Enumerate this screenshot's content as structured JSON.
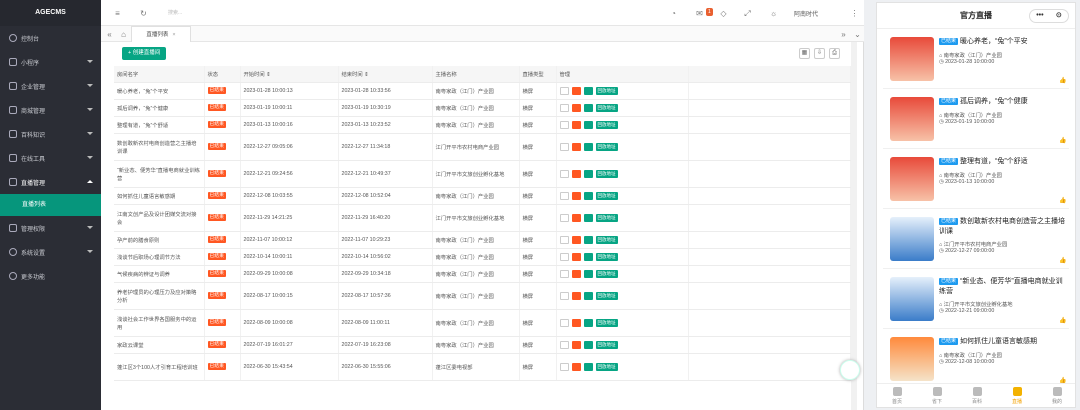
{
  "sidebar": {
    "brand": "AGECMS",
    "items": [
      {
        "label": "控制台",
        "icon": "dashboard-icon"
      },
      {
        "label": "小程序",
        "icon": "miniprogram-icon"
      },
      {
        "label": "企业管理",
        "icon": "enterprise-icon"
      },
      {
        "label": "商城管理",
        "icon": "shop-icon"
      },
      {
        "label": "百科知识",
        "icon": "encyclopedia-icon"
      },
      {
        "label": "在线工具",
        "icon": "tools-icon"
      },
      {
        "label": "直播管理",
        "icon": "live-icon"
      },
      {
        "label": "管理权限",
        "icon": "permission-icon"
      },
      {
        "label": "系统设置",
        "icon": "settings-icon"
      },
      {
        "label": "更多功能",
        "icon": "more-icon"
      }
    ],
    "active_sub": "直播列表"
  },
  "topbar": {
    "search_placeholder": "搜索...",
    "notice_count": "1",
    "user": "阿南时代"
  },
  "tabs": {
    "active": "直播列表"
  },
  "content": {
    "create_label": "+ 创建直播间",
    "columns": [
      "房间名字",
      "状态",
      "开始时间 ⇕",
      "结束时间 ⇕",
      "主播名称",
      "直播类型",
      "管理"
    ],
    "status_label": "已结束",
    "live_button": "回放地址",
    "rows": [
      {
        "name": "暖心养老，“兔”个平安",
        "start": "2023-01-28 10:00:13",
        "end": "2023-01-28 10:33:56",
        "anchor": "南粤家政（江门）产业园",
        "type": "横屏"
      },
      {
        "name": "孤后调养，“兔”个健康",
        "start": "2023-01-19 10:00:11",
        "end": "2023-01-19 10:30:19",
        "anchor": "南粤家政（江门）产业园",
        "type": "横屏"
      },
      {
        "name": "整理有道，“兔”个舒适",
        "start": "2023-01-13 10:00:16",
        "end": "2023-01-13 10:23:52",
        "anchor": "南粤家政（江门）产业园",
        "type": "横屏"
      },
      {
        "name": "数创敢新农村电商创造营之主播培训课",
        "start": "2022-12-27 09:05:06",
        "end": "2022-12-27 11:34:18",
        "anchor": "江门开平市农村电商产业园",
        "type": "横屏"
      },
      {
        "name": "“新业态、便芳华”直播电商就业训练营",
        "start": "2022-12-21 09:24:56",
        "end": "2022-12-21 10:49:37",
        "anchor": "江门开平市文旅创业孵化基地",
        "type": "横屏"
      },
      {
        "name": "如何抓住儿童语言敏感期",
        "start": "2022-12-08 10:03:55",
        "end": "2022-12-08 10:52:04",
        "anchor": "南粤家政（江门）产业园",
        "type": "横屏"
      },
      {
        "name": "江南文创产品及设计团媒交流对接会",
        "start": "2022-11-29 14:21:25",
        "end": "2022-11-29 16:40:20",
        "anchor": "江门开平市文旅创业孵化基地",
        "type": "横屏"
      },
      {
        "name": "孕产前的膳食原则",
        "start": "2022-11-07 10:00:12",
        "end": "2022-11-07 10:29:23",
        "anchor": "南粤家政（江门）产业园",
        "type": "横屏"
      },
      {
        "name": "浅谈节后职场心理调节方法",
        "start": "2022-10-14 10:00:11",
        "end": "2022-10-14 10:56:02",
        "anchor": "南粤家政（江门）产业园",
        "type": "横屏"
      },
      {
        "name": "气候疾病的辨证与调养",
        "start": "2022-09-29 10:00:08",
        "end": "2022-09-29 10:34:18",
        "anchor": "南粤家政（江门）产业园",
        "type": "横屏"
      },
      {
        "name": "养老护理员的心理压力及应对策略分析",
        "start": "2022-08-17 10:00:15",
        "end": "2022-08-17 10:57:36",
        "anchor": "南粤家政（江门）产业园",
        "type": "横屏"
      },
      {
        "name": "浅谈社会工作世界各国服务中的运用",
        "start": "2022-08-09 10:00:08",
        "end": "2022-08-09 11:00:11",
        "anchor": "南粤家政（江门）产业园",
        "type": "横屏"
      },
      {
        "name": "家政云课堂",
        "start": "2022-07-19 16:01:27",
        "end": "2022-07-19 16:23:08",
        "anchor": "南粤家政（江门）产业园",
        "type": "横屏"
      },
      {
        "name": "蓬江区3个100人才引育工程培训班",
        "start": "2022-06-30 15:43:54",
        "end": "2022-06-30 15:55:06",
        "anchor": "蓬江区委电视部",
        "type": "横屏"
      }
    ]
  },
  "phone": {
    "title": "官方直播",
    "capsule_dots": "•••",
    "capsule_close": "⊙",
    "tag": "已结束",
    "cards": [
      {
        "title": "暖心养老，“兔”个平安",
        "anchor": "南粤家政（江门）产业园",
        "time": "2023-01-28 10:00:00",
        "thumb": "red"
      },
      {
        "title": "孤后调养，“兔”个健康",
        "anchor": "南粤家政（江门）产业园",
        "time": "2023-01-19 10:00:00",
        "thumb": "red"
      },
      {
        "title": "整理有道，“兔”个舒适",
        "anchor": "南粤家政（江门）产业园",
        "time": "2023-01-13 10:00:00",
        "thumb": "red"
      },
      {
        "title": "数创敢新农村电商创造营之主播培训课",
        "anchor": "江门开平市农村电商产业园",
        "time": "2022-12-27 09:00:00",
        "thumb": "blue"
      },
      {
        "title": "“新业态、便芳华”直播电商就业训练营",
        "anchor": "江门开平市文旅创业孵化基地",
        "time": "2022-12-21 09:00:00",
        "thumb": "blue"
      },
      {
        "title": "如何抓住儿童语言敏感期",
        "anchor": "南粤家政（江门）产业园",
        "time": "2022-12-08 10:00:00",
        "thumb": "orange"
      }
    ],
    "nav": [
      "首页",
      "省下",
      "百科",
      "直播",
      "我的"
    ],
    "nav_active": 3
  }
}
